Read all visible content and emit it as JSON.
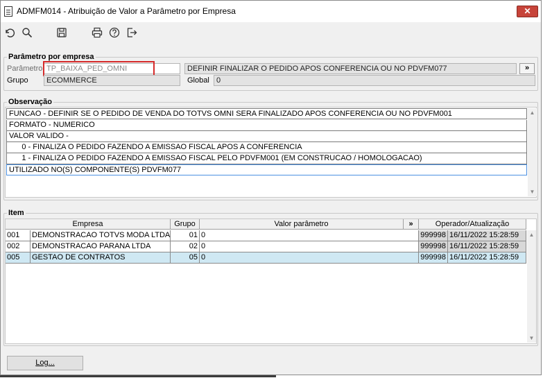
{
  "window": {
    "title": "ADMFM014 - Atribuição de Valor a Parâmetro por Empresa",
    "close_label": "✕"
  },
  "toolbar": {
    "icons": [
      "undo-icon",
      "search-icon",
      "save-icon",
      "print-icon",
      "help-icon",
      "exit-icon"
    ]
  },
  "param_section": {
    "legend": "Parâmetro por empresa",
    "parametro_label": "Parâmetro",
    "parametro_value": "TP_BAIXA_PED_OMNI",
    "description": "DEFINIR FINALIZAR O PEDIDO APOS CONFERENCIA OU NO PDVFM077",
    "expand_label": "»",
    "grupo_label": "Grupo",
    "grupo_value": "ECOMMERCE",
    "global_label": "Global",
    "global_value": "0"
  },
  "obs_section": {
    "legend": "Observação",
    "lines": [
      "FUNCAO - DEFINIR SE O PEDIDO DE VENDA DO TOTVS OMNI SERA FINALIZADO APOS CONFERENCIA OU NO PDVFM001",
      "FORMATO - NUMERICO",
      "VALOR VALIDO -",
      "      0 - FINALIZA O PEDIDO FAZENDO A EMISSAO FISCAL APOS A CONFERENCIA",
      "      1 - FINALIZA O PEDIDO FAZENDO A EMISSAO FISCAL PELO PDVFM001 (EM CONSTRUCAO / HOMOLOGACAO)",
      "UTILIZADO NO(S) COMPONENTE(S) PDVFM077"
    ]
  },
  "item_section": {
    "legend": "Item",
    "columns": {
      "empresa": "Empresa",
      "grupo": "Grupo",
      "valor": "Valor parâmetro",
      "expand": "»",
      "operador": "Operador/Atualização"
    },
    "rows": [
      {
        "code": "001",
        "empresa": "DEMONSTRACAO TOTVS MODA LTDA",
        "grupo": "01",
        "valor": "0",
        "operador": "999998",
        "data": "16/11/2022 15:28:59"
      },
      {
        "code": "002",
        "empresa": "DEMONSTRACAO PARANA LTDA",
        "grupo": "02",
        "valor": "0",
        "operador": "999998",
        "data": "16/11/2022 15:28:59"
      },
      {
        "code": "005",
        "empresa": "GESTAO DE CONTRATOS",
        "grupo": "05",
        "valor": "0",
        "operador": "999998",
        "data": "16/11/2022 15:28:59"
      }
    ]
  },
  "footer": {
    "log_label": "Log..."
  }
}
